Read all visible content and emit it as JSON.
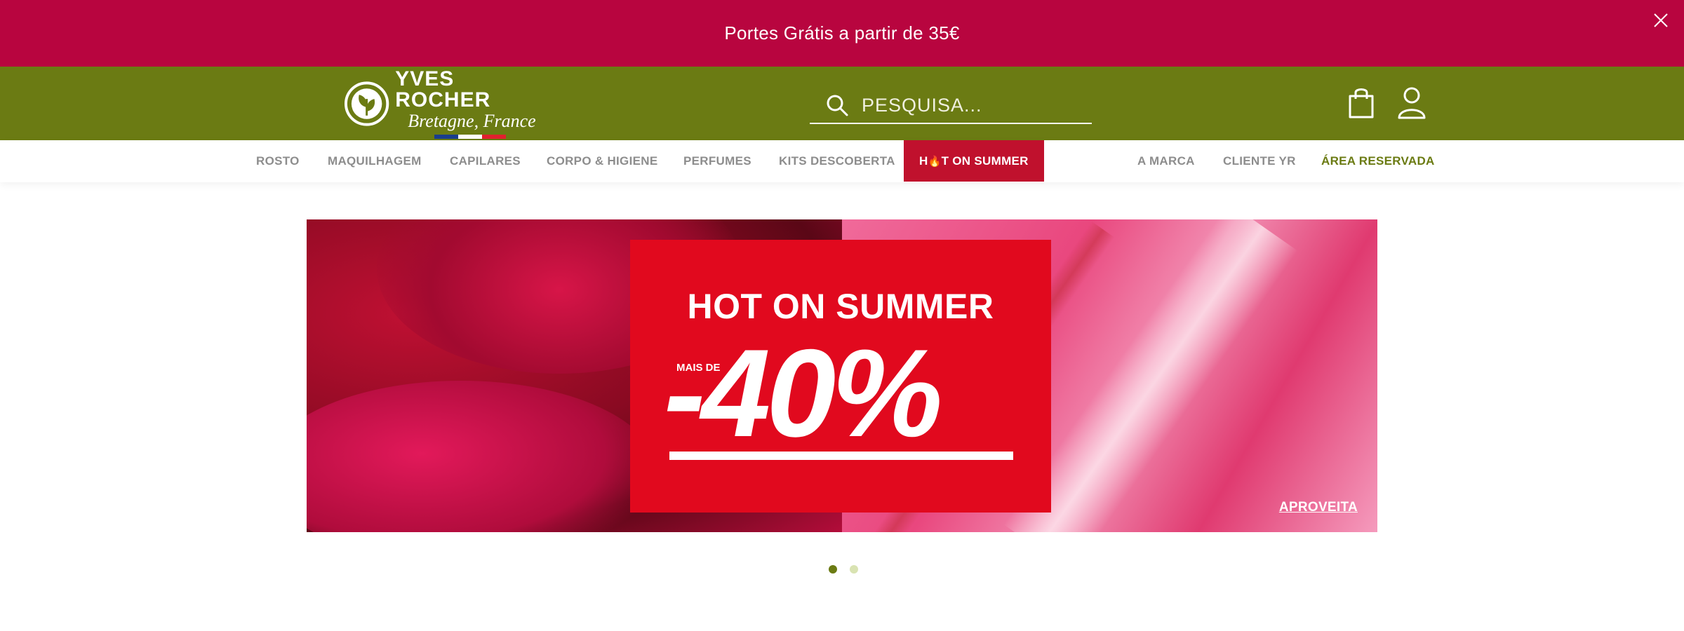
{
  "promo_bar": {
    "text": "Portes Grátis a partir de 35€",
    "close_icon": "close-icon"
  },
  "logo": {
    "name": "YVES ROCHER",
    "subtitle": "Bretagne, France"
  },
  "search": {
    "placeholder": "PESQUISA..."
  },
  "header_icons": {
    "bag": "shopping-bag-icon",
    "account": "user-icon"
  },
  "nav": {
    "left": [
      "ROSTO",
      "MAQUILHAGEM",
      "CAPILARES",
      "CORPO & HIGIENE",
      "PERFUMES",
      "KITS DESCOBERTA"
    ],
    "hot": {
      "prefix": "H",
      "icon": "🔥",
      "suffix": "T ON SUMMER"
    },
    "right": [
      "A MARCA",
      "CLIENTE YR",
      "ÁREA RESERVADA"
    ]
  },
  "banner": {
    "title": "HOT ON SUMMER",
    "prefix": "MAIS DE",
    "discount": "-40%",
    "cta": "APROVEITA"
  },
  "carousel": {
    "total": 2,
    "active": 1
  },
  "colors": {
    "promo_bg": "#b8053f",
    "header_bg": "#6b7b13",
    "hot_bg": "#c0112d",
    "promo_box": "#e1091e",
    "dot_active": "#6b7b13",
    "dot_inactive": "#d9e3b2"
  }
}
